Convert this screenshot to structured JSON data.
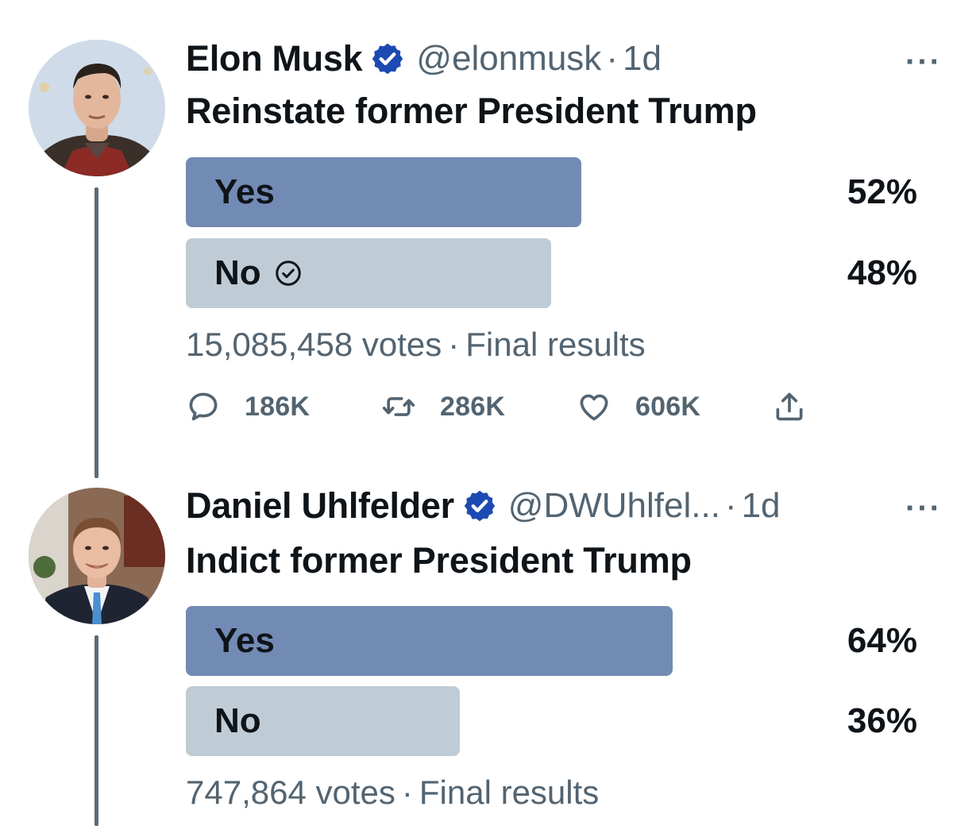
{
  "tweets": [
    {
      "name": "Elon Musk",
      "handle": "@elonmusk",
      "dot": "·",
      "time": "1d",
      "more": "···",
      "text": "Reinstate former President Trump",
      "poll": {
        "options": [
          {
            "label": "Yes",
            "percent_label": "52%",
            "percent": 52,
            "winner": true,
            "selected": false
          },
          {
            "label": "No",
            "percent_label": "48%",
            "percent": 48,
            "winner": false,
            "selected": true
          }
        ],
        "votes": "15,085,458 votes",
        "separator": "·",
        "status": "Final results"
      },
      "actions": {
        "replies": "186K",
        "retweets": "286K",
        "likes": "606K"
      }
    },
    {
      "name": "Daniel Uhlfelder",
      "handle": "@DWUhlfel...",
      "dot": "·",
      "time": "1d",
      "more": "···",
      "text": "Indict former President Trump",
      "poll": {
        "options": [
          {
            "label": "Yes",
            "percent_label": "64%",
            "percent": 64,
            "winner": true,
            "selected": false
          },
          {
            "label": "No",
            "percent_label": "36%",
            "percent": 36,
            "winner": false,
            "selected": false
          }
        ],
        "votes": "747,864 votes",
        "separator": "·",
        "status": "Final results"
      }
    }
  ],
  "colors": {
    "winner_bar": "#728bb4",
    "loser_bar": "#bfccd5",
    "verified": "#1d4ab2",
    "secondary_text": "#536471",
    "thread_line": "#5c6b78"
  },
  "icons": {
    "verified": "verified-badge-icon",
    "reply": "reply-icon",
    "retweet": "retweet-icon",
    "like": "heart-icon",
    "share": "share-icon",
    "selected_choice": "check-circle-icon"
  }
}
